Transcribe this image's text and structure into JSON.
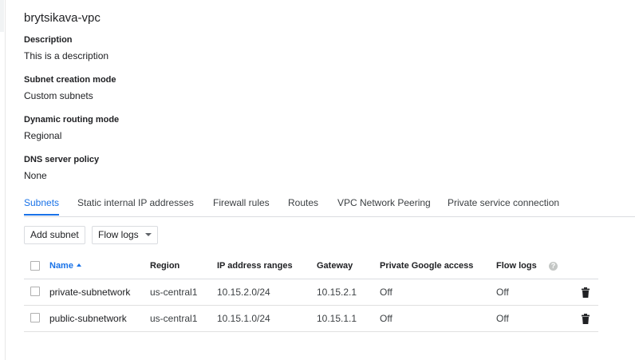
{
  "network": {
    "name": "brytsikava-vpc"
  },
  "details": {
    "description": {
      "label": "Description",
      "value": "This is a description"
    },
    "subnet_mode": {
      "label": "Subnet creation mode",
      "value": "Custom subnets"
    },
    "routing_mode": {
      "label": "Dynamic routing mode",
      "value": "Regional"
    },
    "dns_policy": {
      "label": "DNS server policy",
      "value": "None"
    }
  },
  "tabs": [
    {
      "label": "Subnets",
      "active": true
    },
    {
      "label": "Static internal IP addresses",
      "active": false
    },
    {
      "label": "Firewall rules",
      "active": false
    },
    {
      "label": "Routes",
      "active": false
    },
    {
      "label": "VPC Network Peering",
      "active": false
    },
    {
      "label": "Private service connection",
      "active": false
    }
  ],
  "toolbar": {
    "add_subnet_label": "Add subnet",
    "flow_logs_label": "Flow logs"
  },
  "table": {
    "columns": {
      "name": "Name",
      "region": "Region",
      "ip_ranges": "IP address ranges",
      "gateway": "Gateway",
      "private_access": "Private Google access",
      "flow_logs": "Flow logs"
    },
    "sort": {
      "column": "name",
      "direction": "ascending"
    },
    "help_icon": "help-icon",
    "rows": [
      {
        "name": "private-subnetwork",
        "region": "us-central1",
        "ip_ranges": "10.15.2.0/24",
        "gateway": "10.15.2.1",
        "private_access": "Off",
        "flow_logs": "Off"
      },
      {
        "name": "public-subnetwork",
        "region": "us-central1",
        "ip_ranges": "10.15.1.0/24",
        "gateway": "10.15.1.1",
        "private_access": "Off",
        "flow_logs": "Off"
      }
    ]
  },
  "colors": {
    "accent": "#1a73e8",
    "text": "#202124",
    "divider": "#dadce0"
  }
}
